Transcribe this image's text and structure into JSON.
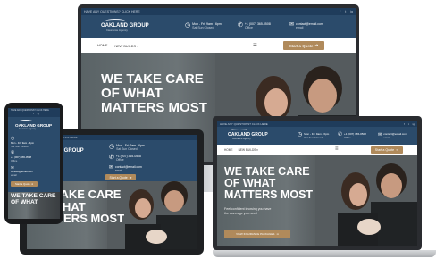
{
  "top_bar": {
    "text": "HAVE ANY QUESTIONS? CLICK HERE",
    "social": [
      "f",
      "t",
      "ig"
    ]
  },
  "logo": {
    "name": "OAKLAND GROUP",
    "tagline": "Insurance Agency"
  },
  "hours": {
    "line1": "Mon - Fri: 9am - 6pm",
    "line2": "Sat Sun Closed"
  },
  "phone": {
    "line1": "+1 (007) 365-0508",
    "line2": "Office"
  },
  "email": {
    "line1": "contact@email.com",
    "line2": "email"
  },
  "nav": {
    "home": "HOME",
    "packages": "NEW BUILDS ▾",
    "quote": "Start a Quote"
  },
  "hero": {
    "line1": "WE TAKE CARE",
    "line2": "OF WHAT",
    "line3": "MATTERS MOST",
    "sub1": "Feel confident knowing you have",
    "sub2": "the coverage you need",
    "cta": "VIEW INSURANCE PACKAGES"
  },
  "icons": {
    "clock": "clock-icon",
    "phone": "phone-icon",
    "mail": "mail-icon",
    "menu": "hamburger-icon"
  },
  "colors": {
    "header": "#2b4b6b",
    "accent": "#b08a5b",
    "strip": "#1f3c5b"
  }
}
